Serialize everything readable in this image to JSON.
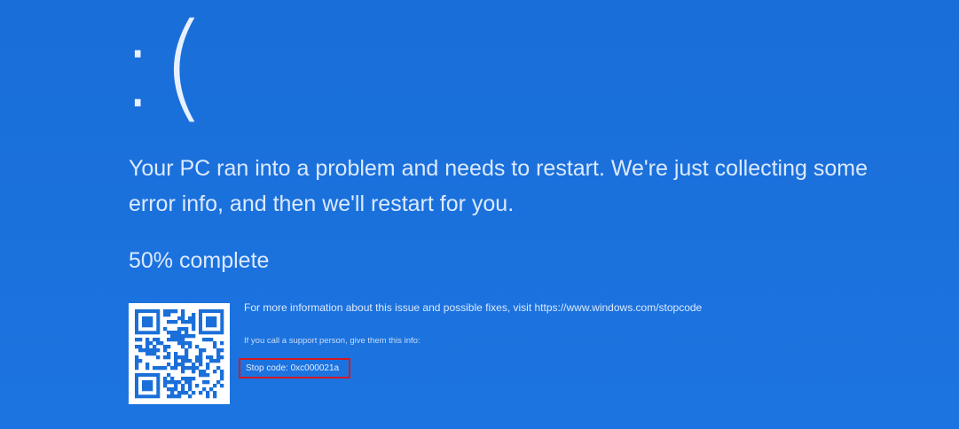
{
  "screen": {
    "face": ":(",
    "message": "Your PC ran into a problem and needs to restart. We're just collecting some error info, and then we'll restart for you.",
    "progress_text": "50% complete",
    "progress_percent": 50,
    "more_info": "For more information about this issue and possible fixes, visit https://www.windows.com/stopcode",
    "support_info": "If you call a support person, give them this info:",
    "stop_code": "Stop code: 0xc000021a"
  },
  "colors": {
    "background": "#1a6fd9",
    "text": "#dceaff",
    "highlight_border": "#d31a22"
  },
  "icons": {
    "qr": "qr-code-icon"
  }
}
